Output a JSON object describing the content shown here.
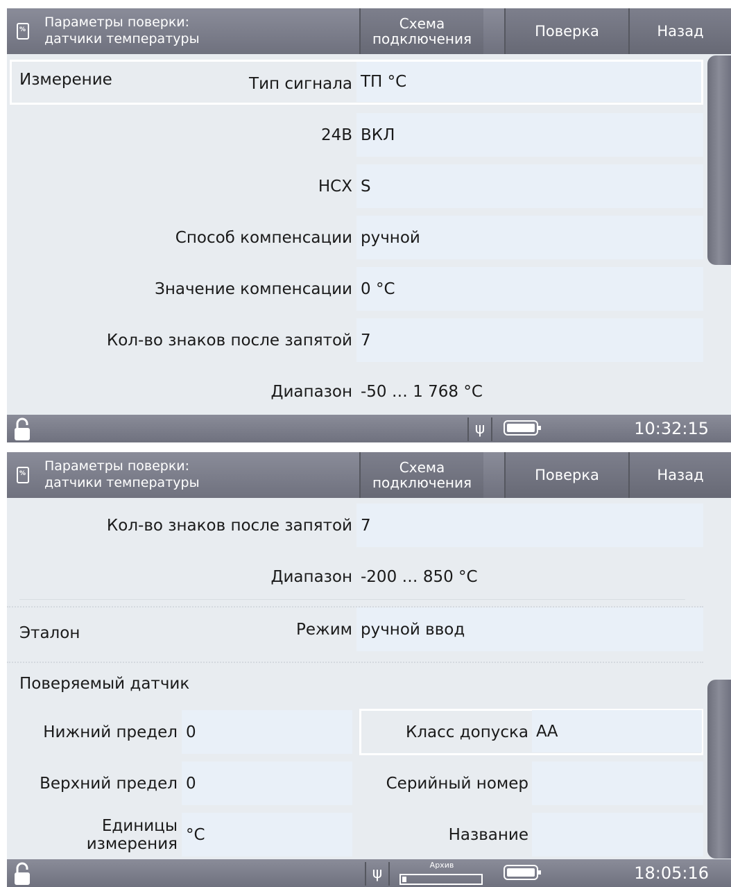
{
  "screen1": {
    "header": {
      "title_line1": "Параметры поверки:",
      "title_line2": "датчики температуры",
      "btn_scheme_line1": "Схема",
      "btn_scheme_line2": "подключения",
      "btn_check": "Поверка",
      "btn_back": "Назад"
    },
    "group_measure": "Измерение",
    "rows": [
      {
        "label": "Тип сигнала",
        "value": "ТП °С"
      },
      {
        "label": "24В",
        "value": "ВКЛ"
      },
      {
        "label": "НСХ",
        "value": "S"
      },
      {
        "label": "Способ компенсации",
        "value": "ручной"
      },
      {
        "label": "Значение компенсации",
        "value": "0 °С"
      },
      {
        "label": "Кол-во знаков после запятой",
        "value": "7"
      },
      {
        "label": "Диапазон",
        "value": "-50 … 1 768 °С"
      }
    ],
    "status": {
      "time": "10:32:15"
    }
  },
  "screen2": {
    "header": {
      "title_line1": "Параметры поверки:",
      "title_line2": "датчики температуры",
      "btn_scheme_line1": "Схема",
      "btn_scheme_line2": "подключения",
      "btn_check": "Поверка",
      "btn_back": "Назад"
    },
    "rows": [
      {
        "label": "Кол-во знаков после запятой",
        "value": "7"
      },
      {
        "label": "Диапазон",
        "value": "-200 … 850 °С"
      }
    ],
    "group_etalon": "Эталон",
    "etalon_mode_label": "Режим",
    "etalon_mode_value": "ручной ввод",
    "group_sensor": "Поверяемый датчик",
    "sensor": {
      "lower_label": "Нижний предел",
      "lower_value": "0",
      "upper_label": "Верхний предел",
      "upper_value": "0",
      "units_label_line1": "Единицы",
      "units_label_line2": "измерения",
      "units_value": "°С",
      "class_label": "Класс допуска",
      "class_value": "АА",
      "serial_label": "Серийный номер",
      "serial_value": "",
      "name_label": "Название",
      "name_value": ""
    },
    "status": {
      "archive_label": "Архив",
      "time": "18:05:16"
    }
  }
}
